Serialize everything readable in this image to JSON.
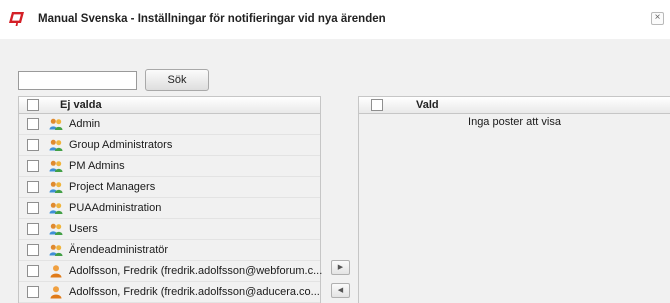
{
  "window": {
    "title": "Manual Svenska - Inställningar för notifieringar vid nya ärenden",
    "close_glyph": "×"
  },
  "search": {
    "value": "",
    "placeholder": "",
    "button_label": "Sök"
  },
  "left_list": {
    "header": "Ej valda",
    "rows": [
      {
        "label": "Admin",
        "icon": "group-icon",
        "checked": false
      },
      {
        "label": "Group Administrators",
        "icon": "group-icon",
        "checked": false
      },
      {
        "label": "PM Admins",
        "icon": "group-icon",
        "checked": false
      },
      {
        "label": "Project Managers",
        "icon": "group-icon",
        "checked": false
      },
      {
        "label": "PUAAdministration",
        "icon": "group-icon",
        "checked": false
      },
      {
        "label": "Users",
        "icon": "group-icon",
        "checked": false
      },
      {
        "label": "Ärendeadministratör",
        "icon": "group-icon",
        "checked": false
      },
      {
        "label": "Adolfsson, Fredrik (fredrik.adolfsson@webforum.c...",
        "icon": "user-icon",
        "checked": false
      },
      {
        "label": "Adolfsson, Fredrik (fredrik.adolfsson@aducera.co...",
        "icon": "user-icon",
        "checked": false
      }
    ]
  },
  "right_list": {
    "header": "Vald",
    "empty_text": "Inga poster att visa"
  },
  "move_buttons": {
    "add_glyph": "▶",
    "remove_glyph": "◀"
  },
  "colors": {
    "logo_red": "#d41f26",
    "panel_bg": "#f1f1f1",
    "border": "#c6c6c6"
  }
}
